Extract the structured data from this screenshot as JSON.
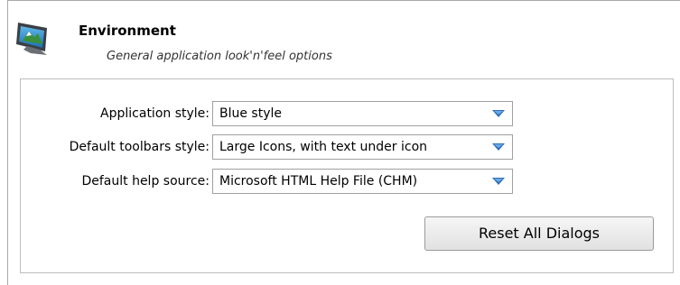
{
  "header": {
    "title": "Environment",
    "subtitle": "General application look'n'feel options",
    "icon": "monitor-icon"
  },
  "settings": [
    {
      "label": "Application style:",
      "value": "Blue style"
    },
    {
      "label": "Default toolbars style:",
      "value": "Large Icons, with text under icon"
    },
    {
      "label": "Default help source:",
      "value": "Microsoft HTML Help File (CHM)"
    }
  ],
  "actions": {
    "reset_label": "Reset All Dialogs"
  },
  "colors": {
    "dropdown_arrow": "#2f6fb7",
    "panel_border": "#bdbdbd"
  }
}
